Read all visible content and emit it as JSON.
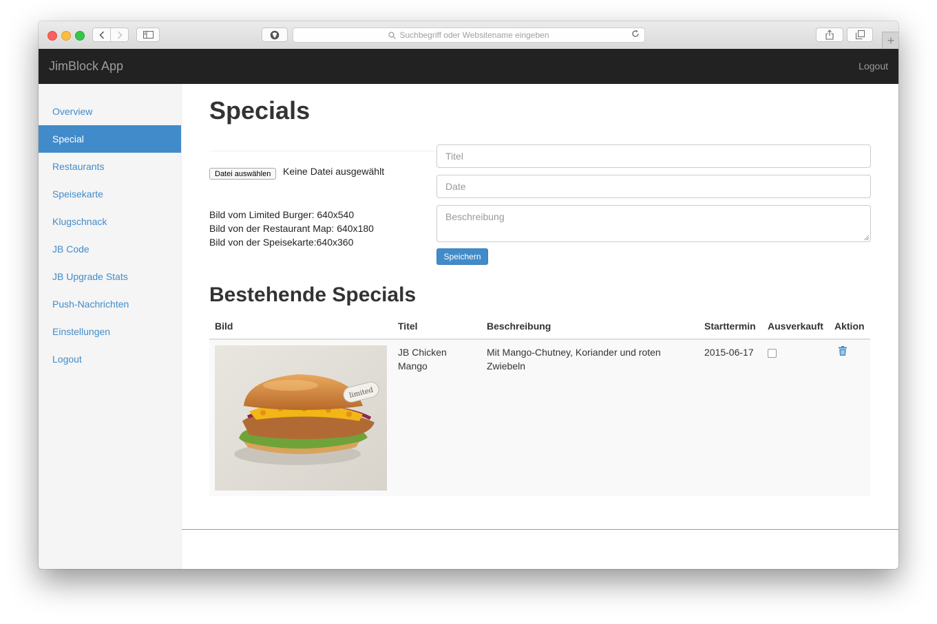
{
  "browser": {
    "url_placeholder": "Suchbegriff oder Websitename eingeben"
  },
  "navbar": {
    "brand": "JimBlock App",
    "logout": "Logout"
  },
  "sidebar": {
    "items": [
      {
        "label": "Overview"
      },
      {
        "label": "Special",
        "active": true
      },
      {
        "label": "Restaurants"
      },
      {
        "label": "Speisekarte"
      },
      {
        "label": "Klugschnack"
      },
      {
        "label": "JB Code"
      },
      {
        "label": "JB Upgrade Stats"
      },
      {
        "label": "Push-Nachrichten"
      },
      {
        "label": "Einstellungen"
      },
      {
        "label": "Logout"
      }
    ]
  },
  "page": {
    "title": "Specials"
  },
  "upload": {
    "button": "Datei auswählen",
    "status": "Keine Datei ausgewählt",
    "hints": [
      "Bild vom Limited Burger: 640x540",
      "Bild von der Restaurant Map: 640x180",
      "Bild von der Speisekarte:640x360"
    ]
  },
  "form": {
    "title_placeholder": "Titel",
    "date_placeholder": "Date",
    "description_placeholder": "Beschreibung",
    "save": "Speichern"
  },
  "existing": {
    "heading": "Bestehende Specials",
    "columns": [
      "Bild",
      "Titel",
      "Beschreibung",
      "Starttermin",
      "Ausverkauft",
      "Aktion"
    ],
    "rows": [
      {
        "image": "burger-image",
        "title": "JB Chicken Mango",
        "description": "Mit Mango-Chutney, Koriander und roten Zwiebeln",
        "start": "2015-06-17",
        "sold_out": false,
        "action_icon": "trash-icon"
      }
    ],
    "image_badge": "limited"
  },
  "colors": {
    "accent": "#428bca",
    "navbar": "#222222",
    "sidebar": "#f5f5f5"
  }
}
